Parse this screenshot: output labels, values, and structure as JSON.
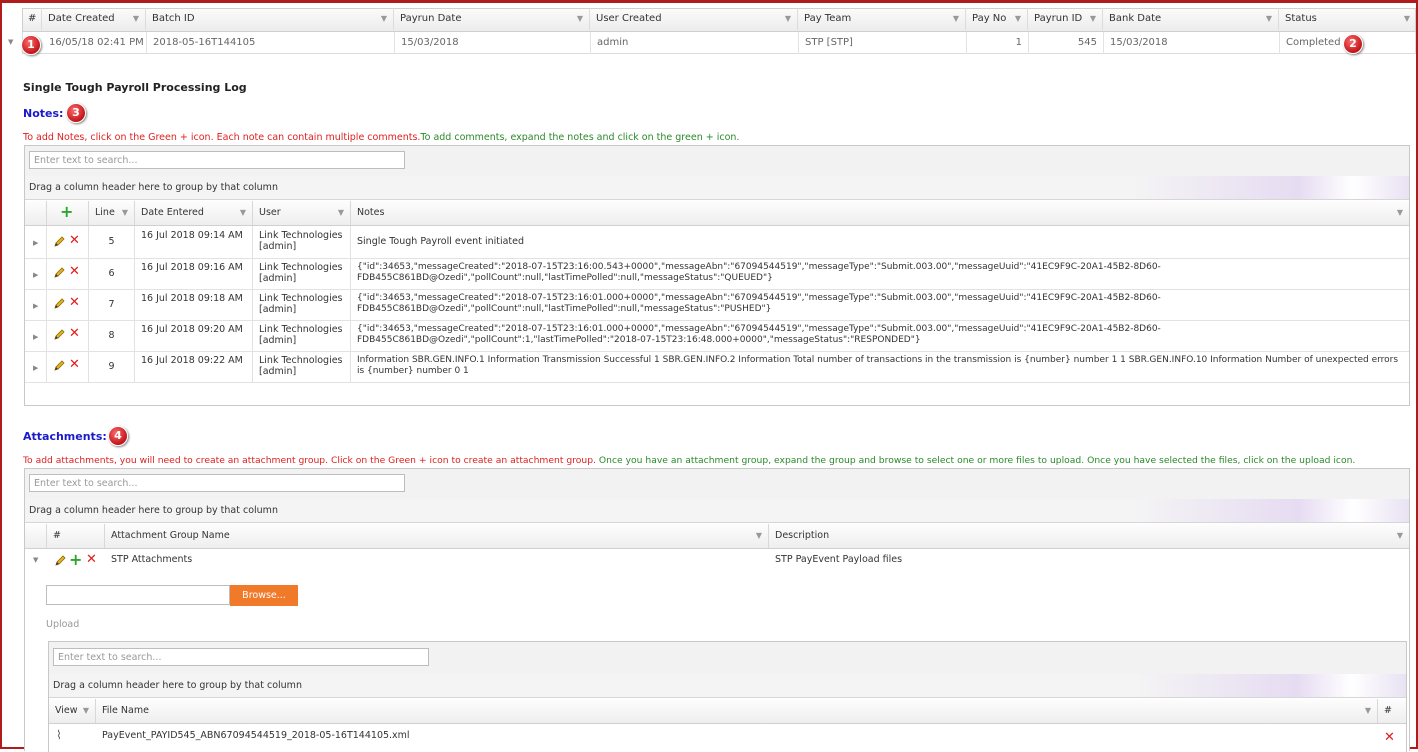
{
  "colors": {
    "accent": "#b01c1c",
    "notes_heading": "#1a1acc",
    "instr_red": "#e02020",
    "instr_green": "#2a8a2a",
    "browse": "#f07a2a"
  },
  "payrun_table": {
    "headers": [
      "#",
      "Date Created",
      "Batch ID",
      "Payrun Date",
      "User Created",
      "Pay Team",
      "Pay No",
      "Payrun ID",
      "Bank Date",
      "Status"
    ],
    "row": {
      "date_created": "16/05/18 02:41 PM",
      "batch_id": "2018-05-16T144105",
      "payrun_date": "15/03/2018",
      "user_created": "admin",
      "pay_team": "STP [STP]",
      "pay_no": "1",
      "payrun_id": "545",
      "bank_date": "15/03/2018",
      "status": "Completed"
    }
  },
  "badges": [
    "1",
    "2",
    "3",
    "4"
  ],
  "log_title": "Single Tough Payroll Processing Log",
  "notes": {
    "heading": "Notes:",
    "instr_red": "To add Notes, click on the Green + icon. Each note can contain multiple comments.",
    "instr_green": "To add comments, expand the notes and click on the green + icon.",
    "search_placeholder": "Enter text to search...",
    "group_hint": "Drag a column header here to group by that column",
    "headers": [
      "Line",
      "Date Entered",
      "User",
      "Notes"
    ],
    "rows": [
      {
        "line": "5",
        "date": "16 Jul 2018 09:14 AM",
        "user": "Link Technologies [admin]",
        "note": "Single Tough Payroll event initiated"
      },
      {
        "line": "6",
        "date": "16 Jul 2018 09:16 AM",
        "user": "Link Technologies [admin]",
        "note": "{\"id\":34653,\"messageCreated\":\"2018-07-15T23:16:00.543+0000\",\"messageAbn\":\"67094544519\",\"messageType\":\"Submit.003.00\",\"messageUuid\":\"41EC9F9C-20A1-45B2-8D60-FDB455C861BD@Ozedi\",\"pollCount\":null,\"lastTimePolled\":null,\"messageStatus\":\"QUEUED\"}"
      },
      {
        "line": "7",
        "date": "16 Jul 2018 09:18 AM",
        "user": "Link Technologies [admin]",
        "note": "{\"id\":34653,\"messageCreated\":\"2018-07-15T23:16:01.000+0000\",\"messageAbn\":\"67094544519\",\"messageType\":\"Submit.003.00\",\"messageUuid\":\"41EC9F9C-20A1-45B2-8D60-FDB455C861BD@Ozedi\",\"pollCount\":null,\"lastTimePolled\":null,\"messageStatus\":\"PUSHED\"}"
      },
      {
        "line": "8",
        "date": "16 Jul 2018 09:20 AM",
        "user": "Link Technologies [admin]",
        "note": "{\"id\":34653,\"messageCreated\":\"2018-07-15T23:16:01.000+0000\",\"messageAbn\":\"67094544519\",\"messageType\":\"Submit.003.00\",\"messageUuid\":\"41EC9F9C-20A1-45B2-8D60-FDB455C861BD@Ozedi\",\"pollCount\":1,\"lastTimePolled\":\"2018-07-15T23:16:48.000+0000\",\"messageStatus\":\"RESPONDED\"}"
      },
      {
        "line": "9",
        "date": "16 Jul 2018 09:22 AM",
        "user": "Link Technologies [admin]",
        "note": "Information SBR.GEN.INFO.1 Information Transmission Successful 1 SBR.GEN.INFO.2 Information Total number of transactions in the transmission is {number} number 1 1 SBR.GEN.INFO.10 Information Number of unexpected errors is {number} number 0 1"
      }
    ]
  },
  "attachments": {
    "heading": "Attachments:",
    "instr_red": "To add attachments, you will need to create an attachment group. Click on the Green + icon to create an attachment group.",
    "instr_green": " Once you have an attachment group, expand the group and browse to select one or more files to upload. Once you have selected the files, click on the upload icon.",
    "search_placeholder": "Enter text to search...",
    "group_hint": "Drag a column header here to group by that column",
    "headers": [
      "#",
      "Attachment Group Name",
      "Description"
    ],
    "group": {
      "name": "STP Attachments",
      "description": "STP PayEvent Payload files"
    },
    "browse_label": "Browse...",
    "upload_label": "Upload",
    "files": {
      "search_placeholder": "Enter text to search...",
      "group_hint": "Drag a column header here to group by that column",
      "headers": [
        "View",
        "File Name",
        "#"
      ],
      "rows": [
        {
          "file": "PayEvent_PAYID545_ABN67094544519_2018-05-16T144105.xml"
        }
      ]
    }
  }
}
